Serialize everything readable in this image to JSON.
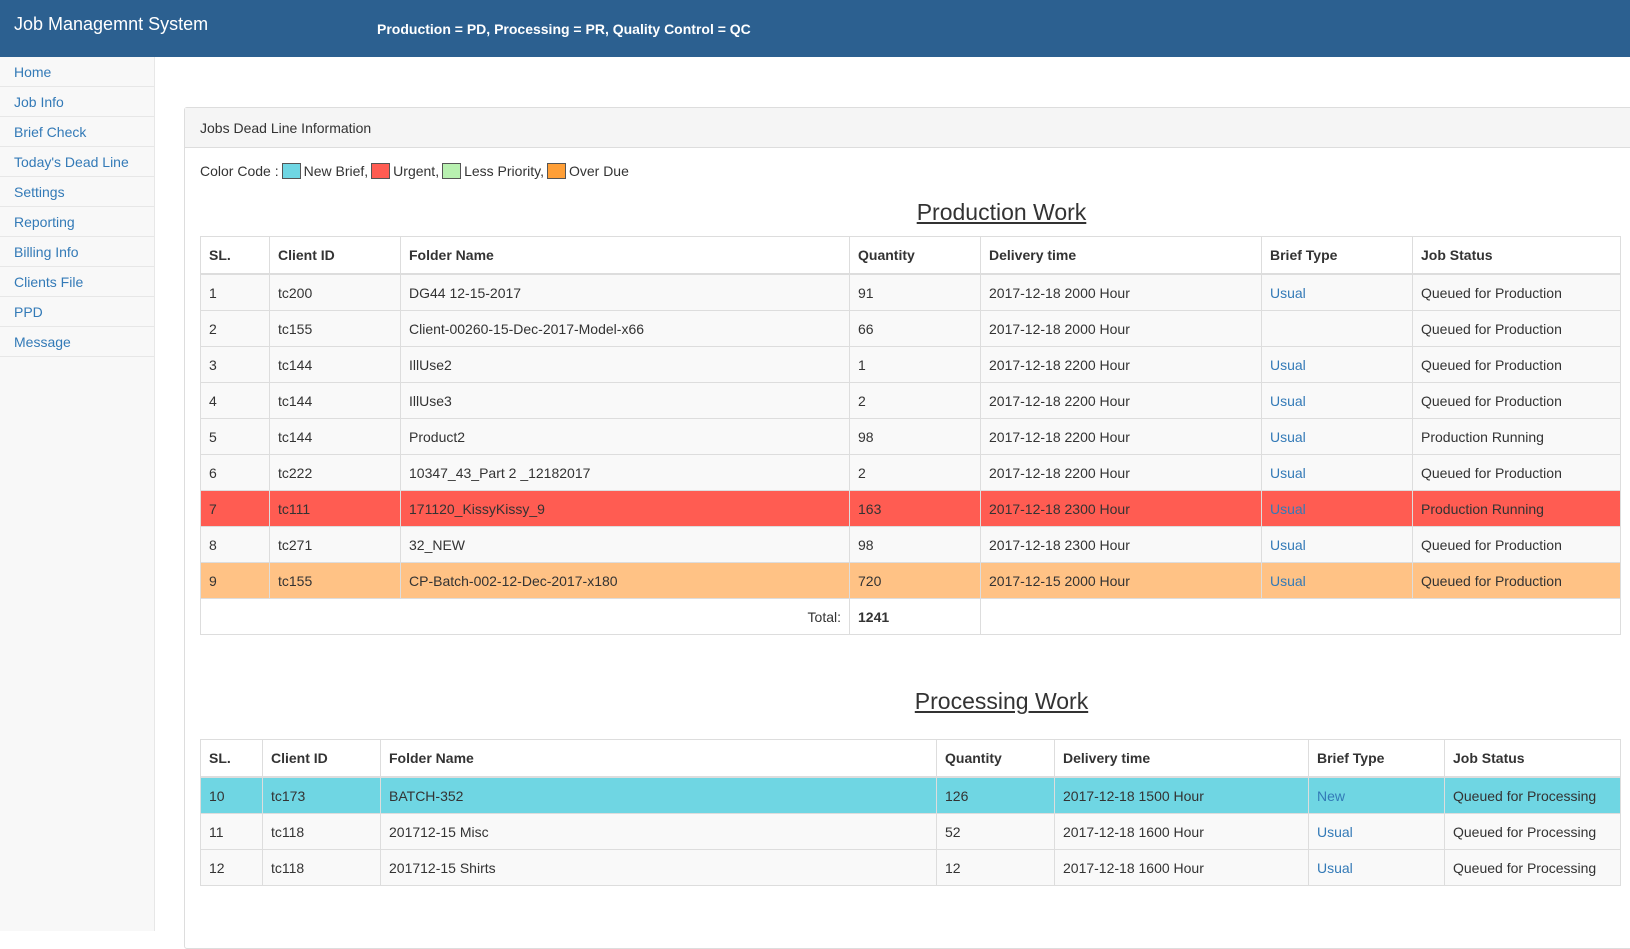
{
  "app": {
    "title": "Job Managemnt System",
    "legend": "Production = PD, Processing = PR, Quality Control = QC"
  },
  "sidebar": {
    "items": [
      {
        "label": "Home"
      },
      {
        "label": "Job Info"
      },
      {
        "label": "Brief Check"
      },
      {
        "label": "Today's Dead Line"
      },
      {
        "label": "Settings"
      },
      {
        "label": "Reporting"
      },
      {
        "label": "Billing Info"
      },
      {
        "label": "Clients File"
      },
      {
        "label": "PPD"
      },
      {
        "label": "Message"
      }
    ]
  },
  "panel": {
    "heading": "Jobs Dead Line Information",
    "color_code": {
      "label": "Color Code :",
      "items": [
        {
          "label": "New Brief,",
          "color": "#6fd6e3"
        },
        {
          "label": "Urgent,",
          "color": "#ff5c52"
        },
        {
          "label": "Less Priority,",
          "color": "#b8f0b0"
        },
        {
          "label": "Over Due",
          "color": "#ff9f37"
        }
      ]
    }
  },
  "production": {
    "title": "Production Work",
    "headers": [
      "SL.",
      "Client ID",
      "Folder Name",
      "Quantity",
      "Delivery time",
      "Brief Type",
      "Job Status"
    ],
    "rows": [
      {
        "sl": "1",
        "client": "tc200",
        "folder": "DG44 12-15-2017",
        "qty": "91",
        "delivery": "2017-12-18 2000 Hour",
        "brief": "Usual",
        "status": "Queued for Production",
        "color": ""
      },
      {
        "sl": "2",
        "client": "tc155",
        "folder": "Client-00260-15-Dec-2017-Model-x66",
        "qty": "66",
        "delivery": "2017-12-18 2000 Hour",
        "brief": "",
        "status": "Queued for Production",
        "color": ""
      },
      {
        "sl": "3",
        "client": "tc144",
        "folder": "IllUse2",
        "qty": "1",
        "delivery": "2017-12-18 2200 Hour",
        "brief": "Usual",
        "status": "Queued for Production",
        "color": ""
      },
      {
        "sl": "4",
        "client": "tc144",
        "folder": "IllUse3",
        "qty": "2",
        "delivery": "2017-12-18 2200 Hour",
        "brief": "Usual",
        "status": "Queued for Production",
        "color": ""
      },
      {
        "sl": "5",
        "client": "tc144",
        "folder": "Product2",
        "qty": "98",
        "delivery": "2017-12-18 2200 Hour",
        "brief": "Usual",
        "status": "Production Running",
        "color": ""
      },
      {
        "sl": "6",
        "client": "tc222",
        "folder": "10347_43_Part 2 _12182017",
        "qty": "2",
        "delivery": "2017-12-18 2200 Hour",
        "brief": "Usual",
        "status": "Queued for Production",
        "color": ""
      },
      {
        "sl": "7",
        "client": "tc111",
        "folder": "171120_KissyKissy_9",
        "qty": "163",
        "delivery": "2017-12-18 2300 Hour",
        "brief": "Usual",
        "status": "Production Running",
        "color": "#ff5c52"
      },
      {
        "sl": "8",
        "client": "tc271",
        "folder": "32_NEW",
        "qty": "98",
        "delivery": "2017-12-18 2300 Hour",
        "brief": "Usual",
        "status": "Queued for Production",
        "color": ""
      },
      {
        "sl": "9",
        "client": "tc155",
        "folder": "CP-Batch-002-12-Dec-2017-x180",
        "qty": "720",
        "delivery": "2017-12-15 2000 Hour",
        "brief": "Usual",
        "status": "Queued for Production",
        "color": "#ffc285"
      }
    ],
    "total_label": "Total:",
    "total_value": "1241"
  },
  "processing": {
    "title": "Processing Work",
    "headers": [
      "SL.",
      "Client ID",
      "Folder Name",
      "Quantity",
      "Delivery time",
      "Brief Type",
      "Job Status"
    ],
    "rows": [
      {
        "sl": "10",
        "client": "tc173",
        "folder": "BATCH-352",
        "qty": "126",
        "delivery": "2017-12-18 1500 Hour",
        "brief": "New",
        "status": "Queued for Processing",
        "color": "#6fd6e3"
      },
      {
        "sl": "11",
        "client": "tc118",
        "folder": "201712-15 Misc",
        "qty": "52",
        "delivery": "2017-12-18 1600 Hour",
        "brief": "Usual",
        "status": "Queued for Processing",
        "color": ""
      },
      {
        "sl": "12",
        "client": "tc118",
        "folder": "201712-15 Shirts",
        "qty": "12",
        "delivery": "2017-12-18 1600 Hour",
        "brief": "Usual",
        "status": "Queued for Processing",
        "color": ""
      }
    ]
  }
}
